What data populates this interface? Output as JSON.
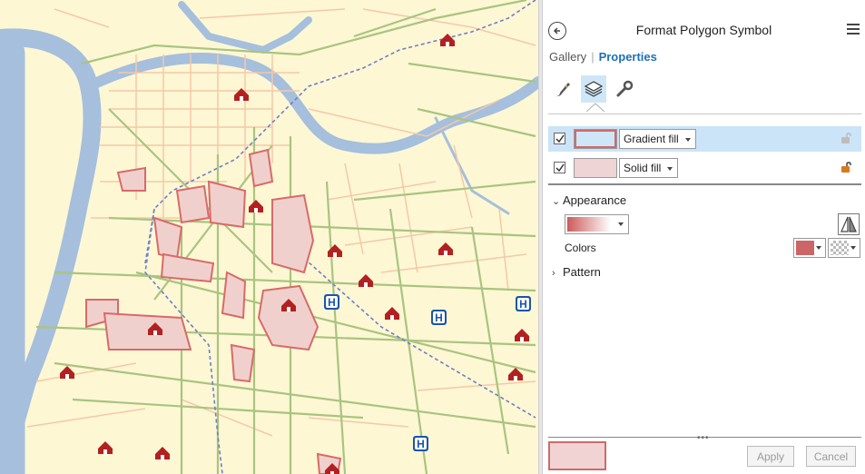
{
  "pane": {
    "title": "Format Polygon Symbol",
    "tabs": {
      "gallery": "Gallery",
      "properties": "Properties"
    },
    "tool_tabs": [
      {
        "name": "paintbrush-icon",
        "active": false
      },
      {
        "name": "layers-icon",
        "active": true
      },
      {
        "name": "wrench-icon",
        "active": false
      }
    ]
  },
  "layers": [
    {
      "checked": true,
      "fill_type": "Gradient fill",
      "swatch_fill": "#cde6f8",
      "swatch_border": "#d06a6a",
      "selected": true,
      "lock_icon": "unlock-icon",
      "lock_color": "#9a9a9a"
    },
    {
      "checked": true,
      "fill_type": "Solid fill",
      "swatch_fill": "#eed4d4",
      "swatch_border": "#eed4d4",
      "selected": false,
      "lock_icon": "unlock-icon",
      "lock_color": "#d87a1e"
    }
  ],
  "appearance": {
    "header": "Appearance",
    "expanded": true,
    "gradient": {
      "from": "#cc5a5a",
      "to": "#ffffff"
    },
    "colors_label": "Colors",
    "color1": "#cc6666",
    "color2": "no-color-checker"
  },
  "pattern": {
    "header": "Pattern",
    "expanded": false
  },
  "footer": {
    "preview_fill": "#f2d3d3",
    "preview_border": "#cc6b6b",
    "apply_label": "Apply",
    "cancel_label": "Cancel",
    "buttons_enabled": false
  },
  "map": {
    "background": "#fdf7d4",
    "water": "#a5bfdd",
    "major_road": "#a9c47f",
    "minor_road": "#f5c8a8",
    "railway": "#6e7fc9",
    "campus_fill": "#f0d0cc",
    "campus_outline": "#d86a6a",
    "symbols": [
      {
        "type": "school-icon",
        "count": 15
      },
      {
        "type": "hospital-icon",
        "label": "H",
        "count": 4
      }
    ]
  }
}
